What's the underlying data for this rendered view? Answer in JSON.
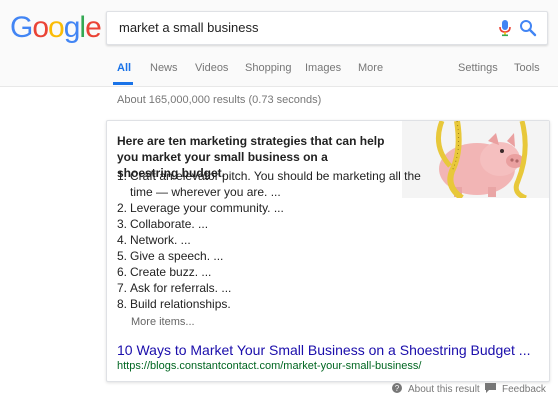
{
  "logo": {
    "text": "Google"
  },
  "colors": {
    "accent": "#1a73e8",
    "link": "#1a0dab",
    "url": "#006621",
    "logo_blue": "#4285F4",
    "logo_red": "#EA4335",
    "logo_yellow": "#FBBC05",
    "logo_green": "#34A853"
  },
  "search": {
    "query": "market a small business"
  },
  "tabs": [
    {
      "label": "All",
      "active": true
    },
    {
      "label": "News"
    },
    {
      "label": "Videos"
    },
    {
      "label": "Shopping"
    },
    {
      "label": "Images"
    },
    {
      "label": "More"
    },
    {
      "label": "Settings"
    },
    {
      "label": "Tools"
    }
  ],
  "result_stats": "About 165,000,000 results (0.73 seconds)",
  "featured": {
    "heading": "Here are ten marketing strategies that can help you market your small business on a shoestring budget.",
    "image": "piggy-bank-with-measuring-tape",
    "steps": [
      {
        "num": "1.",
        "text": "Craft an elevator pitch. You should be marketing all the time — wherever you are. ..."
      },
      {
        "num": "2.",
        "text": "Leverage your community. ..."
      },
      {
        "num": "3.",
        "text": "Collaborate. ..."
      },
      {
        "num": "4.",
        "text": "Network. ..."
      },
      {
        "num": "5.",
        "text": "Give a speech. ..."
      },
      {
        "num": "6.",
        "text": "Create buzz. ..."
      },
      {
        "num": "7.",
        "text": "Ask for referrals. ..."
      },
      {
        "num": "8.",
        "text": "Build relationships."
      }
    ],
    "more_items": "More items...",
    "result_title": "10 Ways to Market Your Small Business on a Shoestring Budget ...",
    "result_url": "https://blogs.constantcontact.com/market-your-small-business/"
  },
  "footer": {
    "about": "About this result",
    "feedback": "Feedback"
  }
}
